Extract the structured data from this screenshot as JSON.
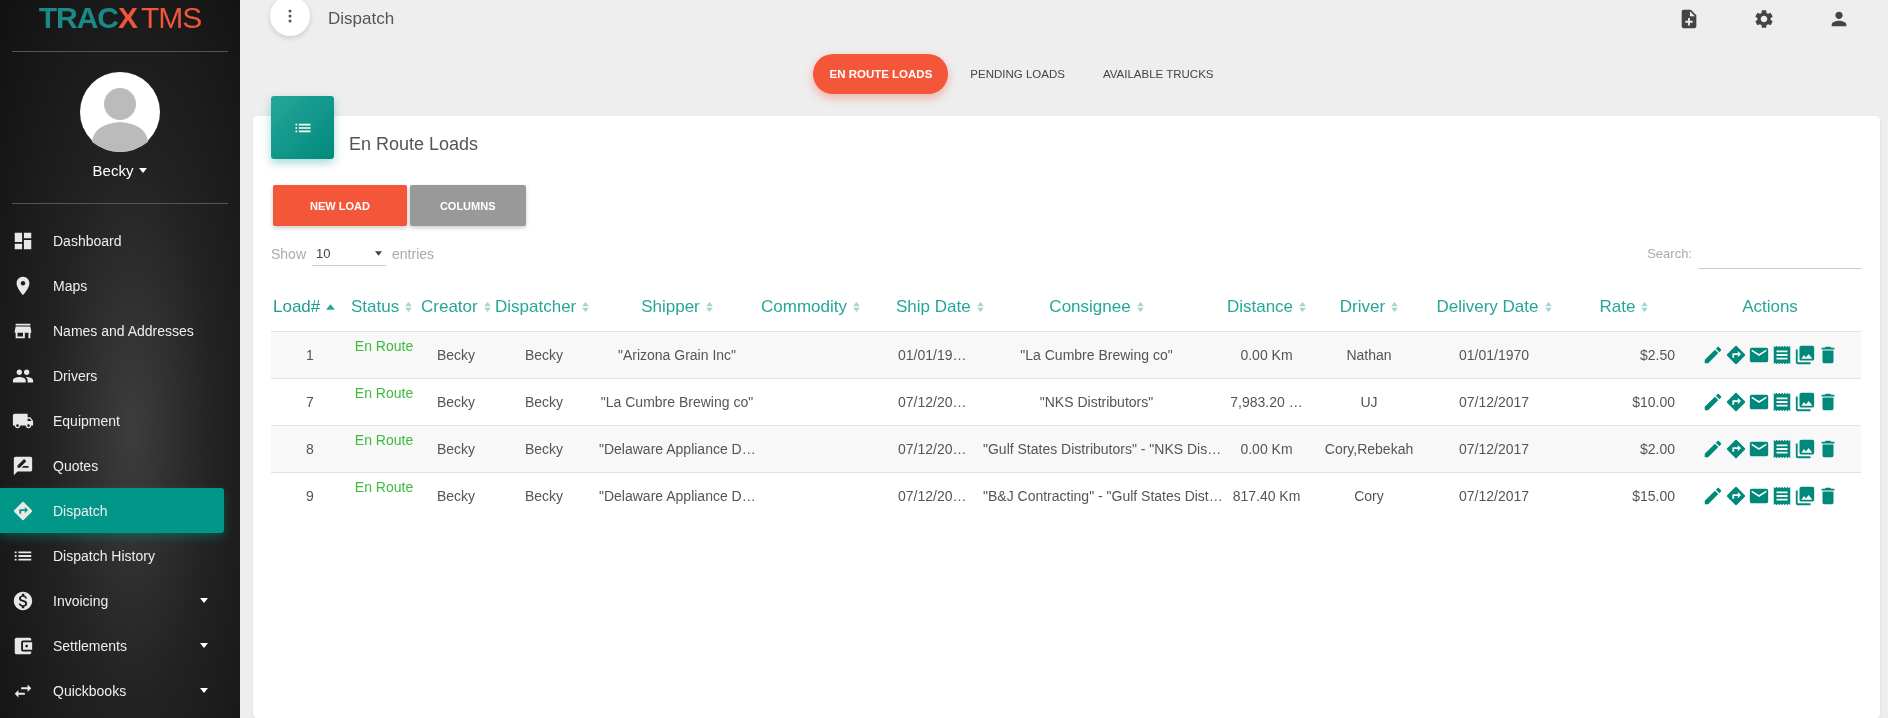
{
  "logo": {
    "brand": "TRAC",
    "accent": "X",
    "suffix": "TMS"
  },
  "user": {
    "name": "Becky"
  },
  "sidebar": {
    "items": [
      {
        "label": "Dashboard",
        "selected": false,
        "expandable": false
      },
      {
        "label": "Maps",
        "selected": false,
        "expandable": false
      },
      {
        "label": "Names and Addresses",
        "selected": false,
        "expandable": false
      },
      {
        "label": "Drivers",
        "selected": false,
        "expandable": false
      },
      {
        "label": "Equipment",
        "selected": false,
        "expandable": false
      },
      {
        "label": "Quotes",
        "selected": false,
        "expandable": false
      },
      {
        "label": "Dispatch",
        "selected": true,
        "expandable": false
      },
      {
        "label": "Dispatch History",
        "selected": false,
        "expandable": false
      },
      {
        "label": "Invoicing",
        "selected": false,
        "expandable": true
      },
      {
        "label": "Settlements",
        "selected": false,
        "expandable": true
      },
      {
        "label": "Quickbooks",
        "selected": false,
        "expandable": true
      }
    ]
  },
  "page_title": "Dispatch",
  "tabs": [
    {
      "label": "EN ROUTE LOADS",
      "selected": true
    },
    {
      "label": "PENDING LOADS",
      "selected": false
    },
    {
      "label": "AVAILABLE TRUCKS",
      "selected": false
    }
  ],
  "card": {
    "title": "En Route Loads",
    "buttons": [
      {
        "label": "NEW LOAD",
        "kind": "primary"
      },
      {
        "label": "COLUMNS",
        "kind": "secondary"
      }
    ],
    "length": {
      "before": "Show",
      "value": "10",
      "after": "entries"
    },
    "search": {
      "label": "Search:"
    },
    "table": {
      "columns": [
        {
          "label": "Load#",
          "sortable": true,
          "sorted": true
        },
        {
          "label": "Status",
          "sortable": true,
          "sorted": false
        },
        {
          "label": "Creator",
          "sortable": true,
          "sorted": false
        },
        {
          "label": "Dispatcher",
          "sortable": true,
          "sorted": false
        },
        {
          "label": "Shipper",
          "sortable": true,
          "sorted": false
        },
        {
          "label": "Commodity",
          "sortable": true,
          "sorted": false
        },
        {
          "label": "Ship Date",
          "sortable": true,
          "sorted": false
        },
        {
          "label": "Consignee",
          "sortable": true,
          "sorted": false
        },
        {
          "label": "Distance",
          "sortable": true,
          "sorted": false
        },
        {
          "label": "Driver",
          "sortable": true,
          "sorted": false
        },
        {
          "label": "Delivery Date",
          "sortable": true,
          "sorted": false
        },
        {
          "label": "Rate",
          "sortable": true,
          "sorted": false
        },
        {
          "label": "Actions",
          "sortable": false,
          "sorted": false
        }
      ],
      "rows": [
        {
          "load": "1",
          "status": "En Route",
          "creator": "Becky",
          "dispatcher": "Becky",
          "shipper": "\"Arizona Grain Inc\"",
          "ship_date": "01/01/19…",
          "consignee": "\"La Cumbre Brewing co\"",
          "distance": "0.00 Km",
          "driver": "Nathan",
          "delivery_date": "01/01/1970",
          "rate": "$2.50"
        },
        {
          "load": "7",
          "status": "En Route",
          "creator": "Becky",
          "dispatcher": "Becky",
          "shipper": "\"La Cumbre Brewing co\"",
          "ship_date": "07/12/20…",
          "consignee": "\"NKS Distributors\"",
          "distance": "7,983.20 …",
          "driver": "UJ",
          "delivery_date": "07/12/2017",
          "rate": "$10.00"
        },
        {
          "load": "8",
          "status": "En Route",
          "creator": "Becky",
          "dispatcher": "Becky",
          "shipper": "\"Delaware Appliance D…",
          "ship_date": "07/12/20…",
          "consignee": "\"Gulf States Distributors\" - \"NKS Dis…",
          "distance": "0.00 Km",
          "driver": "Cory,Rebekah",
          "delivery_date": "07/12/2017",
          "rate": "$2.00"
        },
        {
          "load": "9",
          "status": "En Route",
          "creator": "Becky",
          "dispatcher": "Becky",
          "shipper": "\"Delaware Appliance D…",
          "ship_date": "07/12/20…",
          "consignee": "\"B&J Contracting\" - \"Gulf States Dist…",
          "distance": "817.40 Km",
          "driver": "Cory",
          "delivery_date": "07/12/2017",
          "rate": "$15.00"
        }
      ]
    }
  }
}
